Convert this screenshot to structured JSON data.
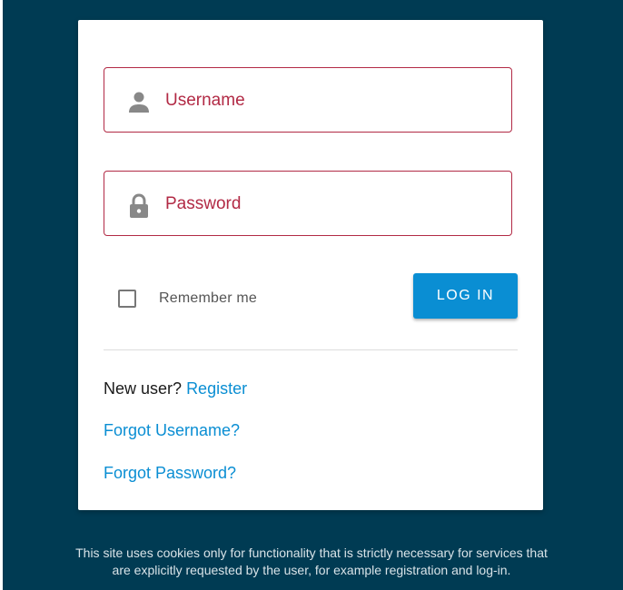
{
  "login_form": {
    "username": {
      "placeholder": "Username",
      "icon": "person-icon"
    },
    "password": {
      "placeholder": "Password",
      "icon": "lock-icon"
    },
    "remember_me": {
      "label": "Remember me",
      "checked": false
    },
    "login_button_label": "LOG IN"
  },
  "links": {
    "new_user_text": "New user?",
    "register_label": "Register",
    "forgot_username_label": "Forgot Username?",
    "forgot_password_label": "Forgot Password?"
  },
  "cookie_notice": {
    "line1": "This site uses cookies only for functionality that is strictly necessary for services that",
    "line2": "are explicitly requested by the user, for example registration and log-in."
  },
  "colors": {
    "background": "#003b53",
    "accent": "#0a8ed3",
    "field_border": "#b22a45"
  }
}
